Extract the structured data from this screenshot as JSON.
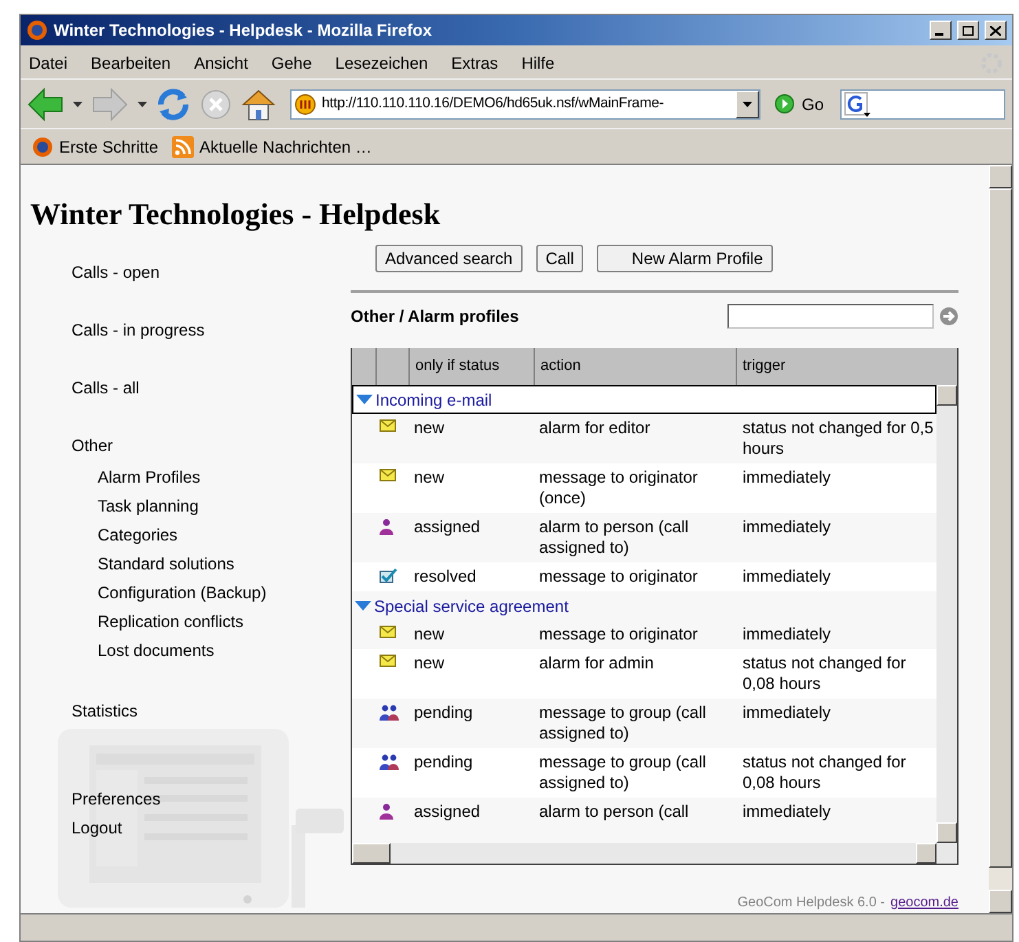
{
  "window": {
    "title": "Winter Technologies - Helpdesk - Mozilla Firefox"
  },
  "menu": [
    "Datei",
    "Bearbeiten",
    "Ansicht",
    "Gehe",
    "Lesezeichen",
    "Extras",
    "Hilfe"
  ],
  "toolbar": {
    "back_disabled": false,
    "forward_disabled": true,
    "stop_disabled": true,
    "address": "http://110.110.110.16/DEMO6/hd65uk.nsf/wMainFrame-",
    "go": "Go"
  },
  "bookmarks": [
    {
      "kind": "firefox",
      "label": "Erste Schritte"
    },
    {
      "kind": "rss",
      "label": "Aktuelle Nachrichten …"
    }
  ],
  "page": {
    "heading": "Winter Technologies - Helpdesk",
    "sidebar": [
      {
        "label": "Calls - open"
      },
      {
        "label": "Calls - in progress"
      },
      {
        "label": "Calls - all"
      },
      {
        "label": "Other",
        "children": [
          {
            "label": "Alarm Profiles"
          },
          {
            "label": "Task planning"
          },
          {
            "label": "Categories"
          },
          {
            "label": "Standard solutions"
          },
          {
            "label": "Configuration (Backup)"
          },
          {
            "label": "Replication conflicts"
          },
          {
            "label": "Lost documents"
          }
        ]
      },
      {
        "label": "Statistics"
      }
    ],
    "sidebar_bottom": [
      "Preferences",
      "Logout"
    ],
    "buttons": [
      "Advanced search",
      "Call",
      "New Alarm Profile"
    ],
    "breadcrumb": "Other / Alarm profiles",
    "table": {
      "columns": [
        "only if status",
        "action",
        "trigger"
      ],
      "groups": [
        {
          "label": "Incoming e-mail",
          "expanded": true,
          "rows": [
            {
              "kind": "envelope",
              "status": "new",
              "action": "alarm for editor",
              "trigger": "status not changed for 0,5 hours"
            },
            {
              "kind": "envelope",
              "status": "new",
              "action": "message to originator (once)",
              "trigger": "immediately"
            },
            {
              "kind": "person",
              "status": "assigned",
              "action": "alarm to person (call assigned to)",
              "trigger": "immediately"
            },
            {
              "kind": "check",
              "status": "resolved",
              "action": "message to originator",
              "trigger": "immediately"
            }
          ]
        },
        {
          "label": "Special service agreement",
          "expanded": true,
          "rows": [
            {
              "kind": "envelope",
              "status": "new",
              "action": "message to originator",
              "trigger": "immediately"
            },
            {
              "kind": "envelope",
              "status": "new",
              "action": "alarm for admin",
              "trigger": "status not changed for 0,08 hours"
            },
            {
              "kind": "group",
              "status": "pending",
              "action": "message to group (call assigned to)",
              "trigger": "immediately"
            },
            {
              "kind": "group",
              "status": "pending",
              "action": "message to group (call assigned to)",
              "trigger": "status not changed for 0,08 hours"
            },
            {
              "kind": "person",
              "status": "assigned",
              "action": "alarm to person (call",
              "trigger": "immediately"
            }
          ]
        }
      ]
    },
    "footer": {
      "text": "GeoCom Helpdesk 6.0 -",
      "link": "geocom.de"
    }
  }
}
